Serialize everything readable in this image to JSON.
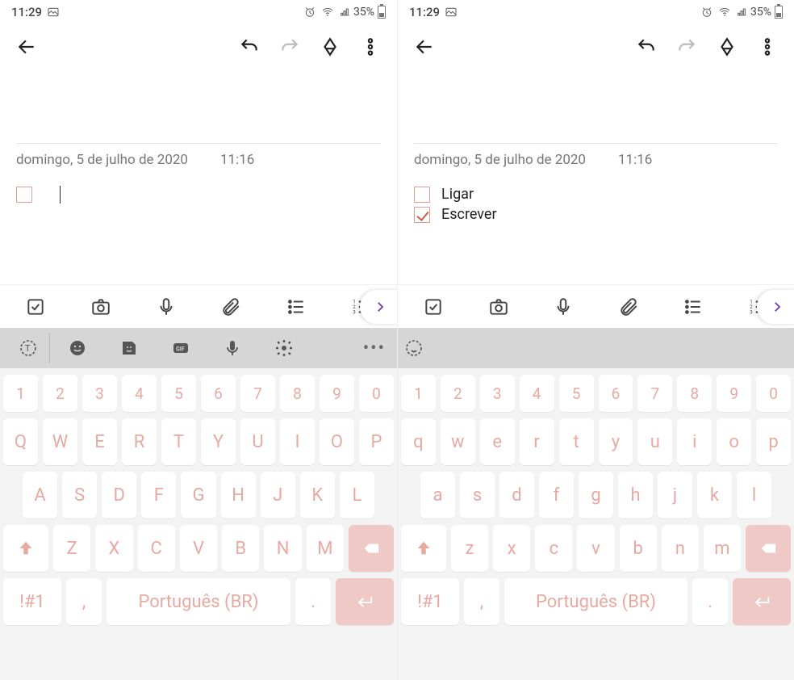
{
  "status": {
    "time": "11:29",
    "battery_pct": "35%"
  },
  "note": {
    "date": "domingo, 5 de julho de 2020",
    "time": "11:16"
  },
  "left": {
    "checklist": [
      {
        "label": "",
        "checked": false,
        "cursor": true
      }
    ]
  },
  "right": {
    "checklist": [
      {
        "label": "Ligar",
        "checked": false
      },
      {
        "label": "Escrever",
        "checked": true
      }
    ]
  },
  "keyboard": {
    "numbers": [
      "1",
      "2",
      "3",
      "4",
      "5",
      "6",
      "7",
      "8",
      "9",
      "0"
    ],
    "row1_upper": [
      "Q",
      "W",
      "E",
      "R",
      "T",
      "Y",
      "U",
      "I",
      "O",
      "P"
    ],
    "row2_upper": [
      "A",
      "S",
      "D",
      "F",
      "G",
      "H",
      "J",
      "K",
      "L"
    ],
    "row3_upper": [
      "Z",
      "X",
      "C",
      "V",
      "B",
      "N",
      "M"
    ],
    "row1_lower": [
      "q",
      "w",
      "e",
      "r",
      "t",
      "y",
      "u",
      "i",
      "o",
      "p"
    ],
    "row2_lower": [
      "a",
      "s",
      "d",
      "f",
      "g",
      "h",
      "j",
      "k",
      "l"
    ],
    "row3_lower": [
      "z",
      "x",
      "c",
      "v",
      "b",
      "n",
      "m"
    ],
    "sym": "!#1",
    "lang": ",",
    "space": "Português (BR)",
    "period": "."
  }
}
